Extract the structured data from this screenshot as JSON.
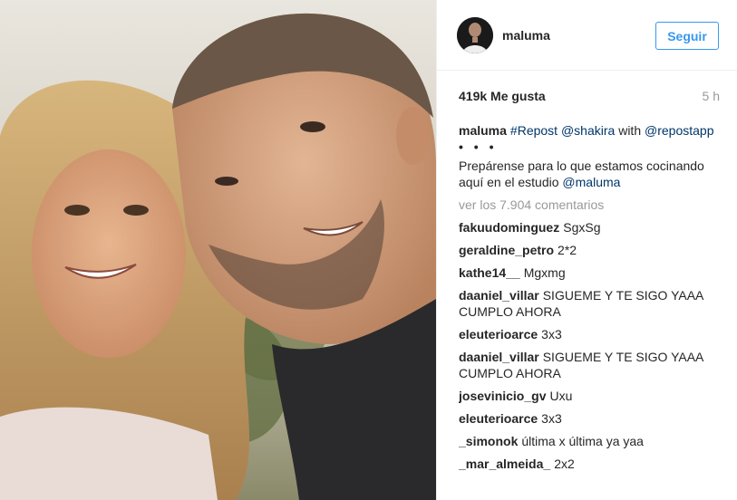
{
  "post": {
    "username": "maluma",
    "follow_label": "Seguir",
    "likes": "419k Me gusta",
    "time_ago": "5 h"
  },
  "caption": {
    "username": "maluma",
    "part1": "#Repost",
    "part2": "@shakira",
    "part3": "with",
    "part4": "@repostapp",
    "dots": "• • •",
    "line2_text": "Prepárense para lo que estamos cocinando aquí en el estudio",
    "line2_mention": "@maluma"
  },
  "view_all": "ver los 7.904 comentarios",
  "comments": [
    {
      "user": "fakuudominguez",
      "text": "SgxSg"
    },
    {
      "user": "geraldine_petro",
      "text": "2*2"
    },
    {
      "user": "kathe14__",
      "text": "Mgxmg"
    },
    {
      "user": "daaniel_villar",
      "text": "SIGUEME Y TE SIGO YAAA CUMPLO AHORA"
    },
    {
      "user": "eleuterioarce",
      "text": "3x3"
    },
    {
      "user": "daaniel_villar",
      "text": "SIGUEME Y TE SIGO YAAA CUMPLO AHORA"
    },
    {
      "user": "josevinicio_gv",
      "text": "Uxu"
    },
    {
      "user": "eleuterioarce",
      "text": "3x3"
    },
    {
      "user": "_simonok",
      "text": "última x última ya yaa"
    },
    {
      "user": "_mar_almeida_",
      "text": "2x2"
    }
  ],
  "colors": {
    "link": "#003569",
    "follow": "#3897f0",
    "muted": "#999999",
    "text": "#262626"
  },
  "icons": {
    "avatar": "profile-photo"
  }
}
